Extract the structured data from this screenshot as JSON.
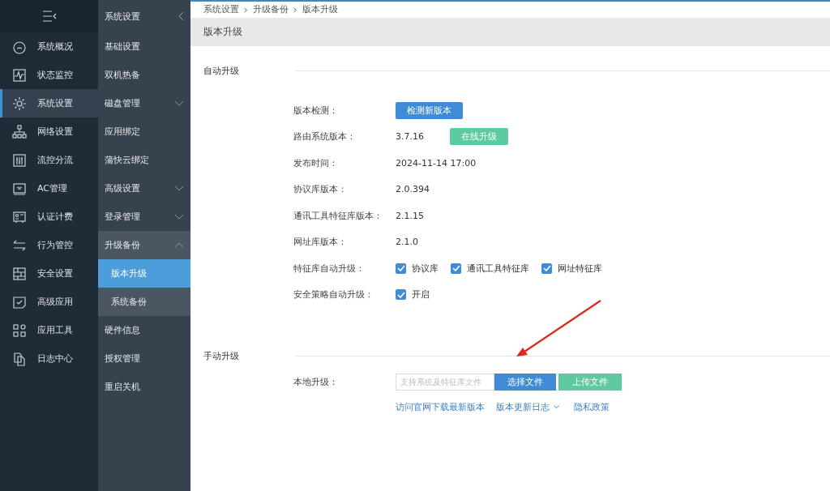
{
  "nav": {
    "items": [
      {
        "label": "系统概况",
        "selected": false
      },
      {
        "label": "状态监控",
        "selected": false
      },
      {
        "label": "系统设置",
        "selected": true
      },
      {
        "label": "网络设置",
        "selected": false
      },
      {
        "label": "流控分流",
        "selected": false
      },
      {
        "label": "AC管理",
        "selected": false
      },
      {
        "label": "认证计费",
        "selected": false
      },
      {
        "label": "行为管控",
        "selected": false
      },
      {
        "label": "安全设置",
        "selected": false
      },
      {
        "label": "高级应用",
        "selected": false
      },
      {
        "label": "应用工具",
        "selected": false
      },
      {
        "label": "日志中心",
        "selected": false
      }
    ]
  },
  "subnav": {
    "title": "系统设置",
    "items": [
      {
        "label": "基础设置",
        "expandable": false,
        "expanded": false
      },
      {
        "label": "双机热备",
        "expandable": false,
        "expanded": false
      },
      {
        "label": "磁盘管理",
        "expandable": true,
        "expanded": false
      },
      {
        "label": "应用绑定",
        "expandable": false,
        "expanded": false
      },
      {
        "label": "蒲快云绑定",
        "expandable": false,
        "expanded": false
      },
      {
        "label": "高级设置",
        "expandable": true,
        "expanded": false
      },
      {
        "label": "登录管理",
        "expandable": true,
        "expanded": false
      },
      {
        "label": "升级备份",
        "expandable": true,
        "expanded": true,
        "children": [
          {
            "label": "版本升级",
            "selected": true
          },
          {
            "label": "系统备份",
            "selected": false
          }
        ]
      },
      {
        "label": "硬件信息",
        "expandable": false,
        "expanded": false
      },
      {
        "label": "授权管理",
        "expandable": false,
        "expanded": false
      },
      {
        "label": "重启关机",
        "expandable": false,
        "expanded": false
      }
    ]
  },
  "breadcrumb": [
    "系统设置",
    "升级备份",
    "版本升级"
  ],
  "page_title": "版本升级",
  "auto_upgrade": {
    "title": "自动升级",
    "rows": [
      {
        "kind": "button",
        "label": "版本检测：",
        "button": "检测新版本"
      },
      {
        "kind": "value_button",
        "label": "路由系统版本：",
        "value": "3.7.16",
        "button": "在线升级"
      },
      {
        "kind": "value",
        "label": "发布时间：",
        "value": "2024-11-14 17:00"
      },
      {
        "kind": "value",
        "label": "协议库版本：",
        "value": "2.0.394"
      },
      {
        "kind": "value",
        "label": "通讯工具特征库版本：",
        "value": "2.1.15"
      },
      {
        "kind": "value",
        "label": "网址库版本：",
        "value": "2.1.0"
      },
      {
        "kind": "checks",
        "label": "特征库自动升级：",
        "options": [
          {
            "label": "协议库",
            "checked": true
          },
          {
            "label": "通讯工具特征库",
            "checked": true
          },
          {
            "label": "网址特征库",
            "checked": true
          }
        ]
      },
      {
        "kind": "checks",
        "label": "安全策略自动升级：",
        "options": [
          {
            "label": "开启",
            "checked": true
          }
        ]
      }
    ]
  },
  "manual_upgrade": {
    "title": "手动升级",
    "label": "本地升级：",
    "file_field": {
      "placeholder": "支持系统及特征库文件"
    },
    "choose_button": "选择文件",
    "upload_button": "上传文件",
    "links": [
      "访问官网下载最新版本",
      "版本更新日志",
      "隐私政策"
    ]
  }
}
